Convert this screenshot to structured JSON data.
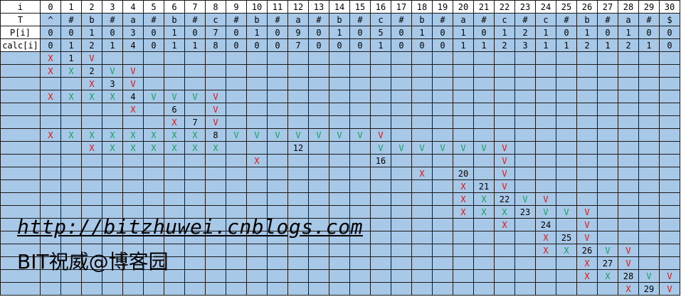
{
  "columns": [
    "0",
    "1",
    "2",
    "3",
    "4",
    "5",
    "6",
    "7",
    "8",
    "9",
    "10",
    "11",
    "12",
    "13",
    "14",
    "15",
    "16",
    "17",
    "18",
    "19",
    "20",
    "21",
    "22",
    "23",
    "24",
    "25",
    "26",
    "27",
    "28",
    "29",
    "30"
  ],
  "header_label": "i",
  "rows": [
    {
      "label": "T",
      "cells": [
        "^",
        "#",
        "b",
        "#",
        "a",
        "#",
        "b",
        "#",
        "c",
        "#",
        "b",
        "#",
        "a",
        "#",
        "b",
        "#",
        "c",
        "#",
        "b",
        "#",
        "a",
        "#",
        "c",
        "#",
        "c",
        "#",
        "b",
        "#",
        "a",
        "#",
        "$"
      ]
    },
    {
      "label": "P[i]",
      "cells": [
        "0",
        "0",
        "1",
        "0",
        "3",
        "0",
        "1",
        "0",
        "7",
        "0",
        "1",
        "0",
        "9",
        "0",
        "1",
        "0",
        "5",
        "0",
        "1",
        "0",
        "1",
        "0",
        "1",
        "2",
        "1",
        "0",
        "1",
        "0",
        "1",
        "0",
        "0"
      ]
    },
    {
      "label": "calc[i]",
      "cells": [
        "0",
        "1",
        "2",
        "1",
        "4",
        "0",
        "1",
        "1",
        "8",
        "0",
        "0",
        "0",
        "7",
        "0",
        "0",
        "0",
        "1",
        "0",
        "0",
        "0",
        "1",
        "1",
        "2",
        "3",
        "1",
        "1",
        "2",
        "1",
        "2",
        "1",
        "0"
      ]
    }
  ],
  "marks": [
    {
      "r": 0,
      "c": 0,
      "t": "X",
      "k": "red"
    },
    {
      "r": 0,
      "c": 1,
      "t": "1",
      "k": "num"
    },
    {
      "r": 0,
      "c": 2,
      "t": "V",
      "k": "red"
    },
    {
      "r": 1,
      "c": 0,
      "t": "X",
      "k": "red"
    },
    {
      "r": 1,
      "c": 1,
      "t": "X",
      "k": "green"
    },
    {
      "r": 1,
      "c": 2,
      "t": "2",
      "k": "num"
    },
    {
      "r": 1,
      "c": 3,
      "t": "V",
      "k": "green"
    },
    {
      "r": 1,
      "c": 4,
      "t": "V",
      "k": "red"
    },
    {
      "r": 2,
      "c": 2,
      "t": "X",
      "k": "red"
    },
    {
      "r": 2,
      "c": 3,
      "t": "3",
      "k": "num"
    },
    {
      "r": 2,
      "c": 4,
      "t": "V",
      "k": "red"
    },
    {
      "r": 3,
      "c": 0,
      "t": "X",
      "k": "red"
    },
    {
      "r": 3,
      "c": 1,
      "t": "X",
      "k": "green"
    },
    {
      "r": 3,
      "c": 2,
      "t": "X",
      "k": "green"
    },
    {
      "r": 3,
      "c": 3,
      "t": "X",
      "k": "green"
    },
    {
      "r": 3,
      "c": 4,
      "t": "4",
      "k": "num"
    },
    {
      "r": 3,
      "c": 5,
      "t": "V",
      "k": "green"
    },
    {
      "r": 3,
      "c": 6,
      "t": "V",
      "k": "green"
    },
    {
      "r": 3,
      "c": 7,
      "t": "V",
      "k": "green"
    },
    {
      "r": 3,
      "c": 8,
      "t": "V",
      "k": "red"
    },
    {
      "r": 4,
      "c": 4,
      "t": "X",
      "k": "red"
    },
    {
      "r": 4,
      "c": 6,
      "t": "6",
      "k": "num"
    },
    {
      "r": 4,
      "c": 8,
      "t": "V",
      "k": "red"
    },
    {
      "r": 5,
      "c": 6,
      "t": "X",
      "k": "red"
    },
    {
      "r": 5,
      "c": 7,
      "t": "7",
      "k": "num"
    },
    {
      "r": 5,
      "c": 8,
      "t": "V",
      "k": "red"
    },
    {
      "r": 6,
      "c": 0,
      "t": "X",
      "k": "red"
    },
    {
      "r": 6,
      "c": 1,
      "t": "X",
      "k": "green"
    },
    {
      "r": 6,
      "c": 2,
      "t": "X",
      "k": "green"
    },
    {
      "r": 6,
      "c": 3,
      "t": "X",
      "k": "green"
    },
    {
      "r": 6,
      "c": 4,
      "t": "X",
      "k": "green"
    },
    {
      "r": 6,
      "c": 5,
      "t": "X",
      "k": "green"
    },
    {
      "r": 6,
      "c": 6,
      "t": "X",
      "k": "green"
    },
    {
      "r": 6,
      "c": 7,
      "t": "X",
      "k": "green"
    },
    {
      "r": 6,
      "c": 8,
      "t": "8",
      "k": "num"
    },
    {
      "r": 6,
      "c": 9,
      "t": "V",
      "k": "green"
    },
    {
      "r": 6,
      "c": 10,
      "t": "V",
      "k": "green"
    },
    {
      "r": 6,
      "c": 11,
      "t": "V",
      "k": "green"
    },
    {
      "r": 6,
      "c": 12,
      "t": "V",
      "k": "green"
    },
    {
      "r": 6,
      "c": 13,
      "t": "V",
      "k": "green"
    },
    {
      "r": 6,
      "c": 14,
      "t": "V",
      "k": "green"
    },
    {
      "r": 6,
      "c": 15,
      "t": "V",
      "k": "green"
    },
    {
      "r": 6,
      "c": 16,
      "t": "V",
      "k": "red"
    },
    {
      "r": 7,
      "c": 2,
      "t": "X",
      "k": "red"
    },
    {
      "r": 7,
      "c": 3,
      "t": "X",
      "k": "green"
    },
    {
      "r": 7,
      "c": 4,
      "t": "X",
      "k": "green"
    },
    {
      "r": 7,
      "c": 5,
      "t": "X",
      "k": "green"
    },
    {
      "r": 7,
      "c": 6,
      "t": "X",
      "k": "green"
    },
    {
      "r": 7,
      "c": 7,
      "t": "X",
      "k": "green"
    },
    {
      "r": 7,
      "c": 8,
      "t": "X",
      "k": "green"
    },
    {
      "r": 7,
      "c": 12,
      "t": "12",
      "k": "num"
    },
    {
      "r": 7,
      "c": 16,
      "t": "V",
      "k": "green"
    },
    {
      "r": 7,
      "c": 17,
      "t": "V",
      "k": "green"
    },
    {
      "r": 7,
      "c": 18,
      "t": "V",
      "k": "green"
    },
    {
      "r": 7,
      "c": 19,
      "t": "V",
      "k": "green"
    },
    {
      "r": 7,
      "c": 20,
      "t": "V",
      "k": "green"
    },
    {
      "r": 7,
      "c": 21,
      "t": "V",
      "k": "green"
    },
    {
      "r": 7,
      "c": 22,
      "t": "V",
      "k": "red"
    },
    {
      "r": 8,
      "c": 10,
      "t": "X",
      "k": "red"
    },
    {
      "r": 8,
      "c": 16,
      "t": "16",
      "k": "num"
    },
    {
      "r": 8,
      "c": 22,
      "t": "V",
      "k": "red"
    },
    {
      "r": 9,
      "c": 18,
      "t": "X",
      "k": "red"
    },
    {
      "r": 9,
      "c": 20,
      "t": "20",
      "k": "num"
    },
    {
      "r": 9,
      "c": 22,
      "t": "V",
      "k": "red"
    },
    {
      "r": 10,
      "c": 20,
      "t": "X",
      "k": "red"
    },
    {
      "r": 10,
      "c": 21,
      "t": "21",
      "k": "num"
    },
    {
      "r": 10,
      "c": 22,
      "t": "V",
      "k": "red"
    },
    {
      "r": 11,
      "c": 20,
      "t": "X",
      "k": "red"
    },
    {
      "r": 11,
      "c": 21,
      "t": "X",
      "k": "green"
    },
    {
      "r": 11,
      "c": 22,
      "t": "22",
      "k": "num"
    },
    {
      "r": 11,
      "c": 23,
      "t": "V",
      "k": "green"
    },
    {
      "r": 11,
      "c": 24,
      "t": "V",
      "k": "red"
    },
    {
      "r": 12,
      "c": 20,
      "t": "X",
      "k": "red"
    },
    {
      "r": 12,
      "c": 21,
      "t": "X",
      "k": "green"
    },
    {
      "r": 12,
      "c": 22,
      "t": "X",
      "k": "green"
    },
    {
      "r": 12,
      "c": 23,
      "t": "23",
      "k": "num"
    },
    {
      "r": 12,
      "c": 24,
      "t": "V",
      "k": "green"
    },
    {
      "r": 12,
      "c": 25,
      "t": "V",
      "k": "green"
    },
    {
      "r": 12,
      "c": 26,
      "t": "V",
      "k": "red"
    },
    {
      "r": 13,
      "c": 22,
      "t": "X",
      "k": "red"
    },
    {
      "r": 13,
      "c": 24,
      "t": "24",
      "k": "num"
    },
    {
      "r": 13,
      "c": 26,
      "t": "V",
      "k": "red"
    },
    {
      "r": 14,
      "c": 24,
      "t": "X",
      "k": "red"
    },
    {
      "r": 14,
      "c": 25,
      "t": "25",
      "k": "num"
    },
    {
      "r": 14,
      "c": 26,
      "t": "V",
      "k": "red"
    },
    {
      "r": 15,
      "c": 24,
      "t": "X",
      "k": "red"
    },
    {
      "r": 15,
      "c": 25,
      "t": "X",
      "k": "green"
    },
    {
      "r": 15,
      "c": 26,
      "t": "26",
      "k": "num"
    },
    {
      "r": 15,
      "c": 27,
      "t": "V",
      "k": "green"
    },
    {
      "r": 15,
      "c": 28,
      "t": "V",
      "k": "red"
    },
    {
      "r": 16,
      "c": 26,
      "t": "X",
      "k": "red"
    },
    {
      "r": 16,
      "c": 27,
      "t": "27",
      "k": "num"
    },
    {
      "r": 16,
      "c": 28,
      "t": "V",
      "k": "red"
    },
    {
      "r": 17,
      "c": 26,
      "t": "X",
      "k": "red"
    },
    {
      "r": 17,
      "c": 27,
      "t": "X",
      "k": "green"
    },
    {
      "r": 17,
      "c": 28,
      "t": "28",
      "k": "num"
    },
    {
      "r": 17,
      "c": 29,
      "t": "V",
      "k": "green"
    },
    {
      "r": 17,
      "c": 30,
      "t": "V",
      "k": "red"
    },
    {
      "r": 18,
      "c": 28,
      "t": "X",
      "k": "red"
    },
    {
      "r": 18,
      "c": 29,
      "t": "29",
      "k": "num"
    },
    {
      "r": 18,
      "c": 30,
      "t": "V",
      "k": "red"
    }
  ],
  "trace_row_count": 19,
  "watermark": {
    "url": "http://bitzhuwei.cnblogs.com",
    "author": "BIT祝威@博客园"
  },
  "colors": {
    "cell_blue": "#a8c8e8",
    "mark_red": "#e01010",
    "mark_green": "#12a060"
  }
}
